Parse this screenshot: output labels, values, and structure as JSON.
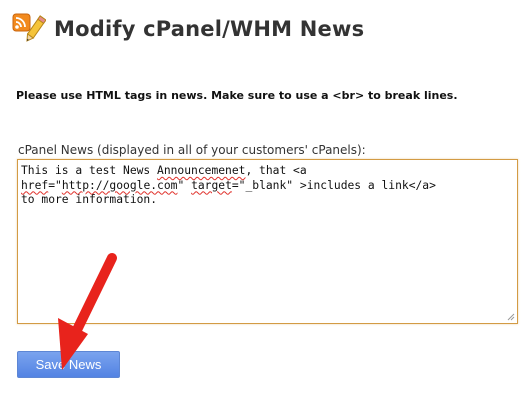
{
  "page": {
    "title": "Modify cPanel/WHM News",
    "icon": "rss-feed-pencil-icon"
  },
  "instructions": "Please use HTML tags in news. Make sure to use a <br> to break lines.",
  "form": {
    "news_label": "cPanel News (displayed in all of your customers' cPanels):",
    "news_value_parts": {
      "p1": "This is a test News ",
      "p2": "Announcemenet",
      "p3": ", that <a\n",
      "p4": "href",
      "p5": "=\"",
      "p6": "http://google.com",
      "p7": "\" ",
      "p8": "target",
      "p9": "=\"_blank\" >includes a link</a>\nto more information."
    },
    "save_label": "Save News"
  },
  "annotation": {
    "arrow_color": "#e8231c",
    "pointing_at": "save-button"
  }
}
